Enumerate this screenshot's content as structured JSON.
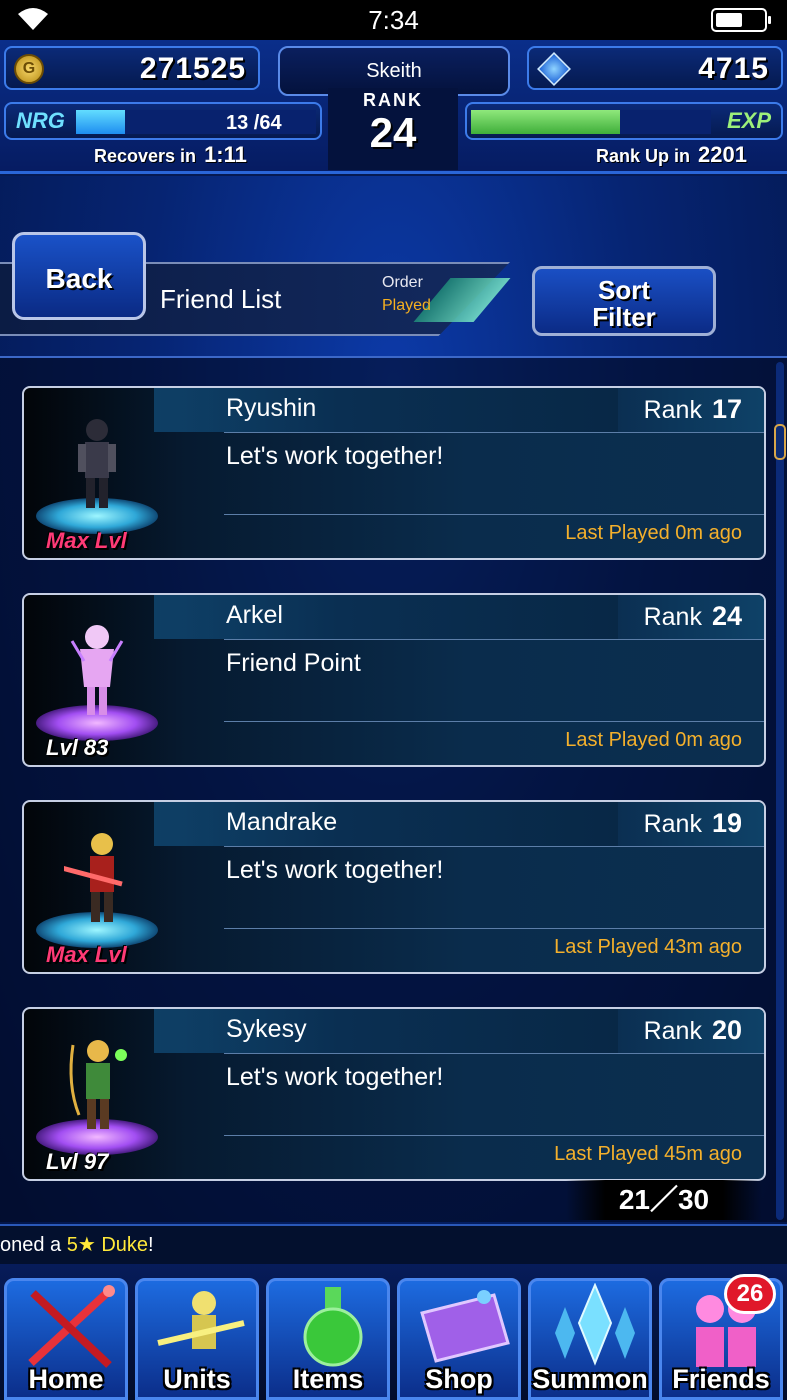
{
  "status_bar": {
    "time": "7:34"
  },
  "hud": {
    "gil": "271525",
    "gems": "4715",
    "player_name": "Skeith",
    "rank_label": "RANK",
    "rank": "24",
    "nrg_label": "NRG",
    "nrg_value": "13 /64",
    "nrg_fraction": 0.203,
    "exp_label": "EXP",
    "exp_fraction": 0.62,
    "recovers_label": "Recovers in",
    "recovers_time": "1:11",
    "rankup_label": "Rank Up in",
    "rankup_value": "2201"
  },
  "header": {
    "back_label": "Back",
    "title": "Friend List",
    "order_label": "Order",
    "order_value": "Played",
    "sort_line1": "Sort",
    "sort_line2": "Filter"
  },
  "rank_word": "Rank",
  "friends": [
    {
      "name": "Ryushin",
      "rank": "17",
      "message": "Let's work together!",
      "last_played": "Last Played 0m ago",
      "level": "Max Lvl",
      "pedestal": "blue"
    },
    {
      "name": "Arkel",
      "rank": "24",
      "message": "Friend Point",
      "last_played": "Last Played 0m ago",
      "level": "Lvl 83",
      "pedestal": "purple"
    },
    {
      "name": "Mandrake",
      "rank": "19",
      "message": "Let's work together!",
      "last_played": "Last Played 43m ago",
      "level": "Max Lvl",
      "pedestal": "blue"
    },
    {
      "name": "Sykesy",
      "rank": "20",
      "message": "Let's work together!",
      "last_played": "Last Played 45m ago",
      "level": "Lvl 97",
      "pedestal": "purple"
    }
  ],
  "page_counter": "21／30",
  "ticker": {
    "prefix": "oned a ",
    "highlight": "5★ Duke",
    "suffix": "!"
  },
  "nav": {
    "home": "Home",
    "units": "Units",
    "items": "Items",
    "shop": "Shop",
    "summon": "Summon",
    "friends": "Friends",
    "friends_badge": "26"
  }
}
